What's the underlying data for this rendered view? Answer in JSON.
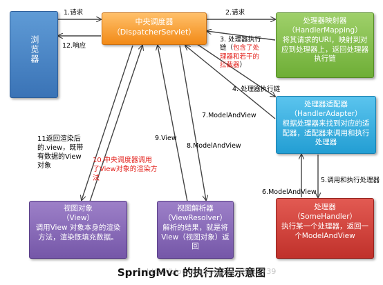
{
  "nodes": {
    "browser": {
      "text": "浏览器"
    },
    "dispatcher": {
      "title": "中央调度器",
      "subtitle": "（DispatcherServlet）"
    },
    "mapping": {
      "title": "处理器映射器",
      "subtitle": "（HandlerMapping）",
      "desc": "将其请求的URI，映射到对应到处理器上，返回处理器执行链"
    },
    "adapter": {
      "title": "处理器适配器",
      "subtitle": "（HandlerAdapter）",
      "desc": "根据处理器来找到对应的适配器，适配器来调用和执行处理器"
    },
    "handler": {
      "title": "处理器",
      "subtitle": "（SomeHandler）",
      "desc": "执行某一个处理器，返回一个ModelAndView"
    },
    "resolver": {
      "title": "视图解析器",
      "subtitle": "（ViewResolver）",
      "desc": "解析的结果，就是将View（视图对象）返回"
    },
    "view": {
      "title": "视图对象",
      "subtitle": "（View）",
      "desc": "调用View 对象本身的渲染方法，渲染既填充数据。"
    }
  },
  "labels": {
    "l1": "1.请求",
    "l12": "12.响应",
    "l2": "2.请求",
    "l3_a": "3. 处理器执行",
    "l3_b": "链（",
    "l3_red1": "包含了处",
    "l3_red2": "理器和若干的",
    "l3_red3": "拦截器",
    "l3_c": "）",
    "l4": "4. 处理器执行链",
    "l7": "7.ModelAndView",
    "l5": "5.调用和执行处理器",
    "l6": "6.ModelAndView",
    "l8": "8.ModelAndView",
    "l9": "9.View",
    "l10": "10.中央调度器调用了View对象的渲染方法",
    "l11": "11返回渲染后的.view，既带有数据的View 对象"
  },
  "caption": "SpringMvc 的执行流程示意图",
  "watermark": "http://blog.csdn.net/qq_28817739",
  "colors": {
    "browser": "#3a73b6",
    "dispatcher": "#f28a17",
    "mapping": "#6eae36",
    "adapter": "#239ed3",
    "view": "#7557a8",
    "resolver": "#7557a8",
    "handler": "#c0312b",
    "highlight_text": "#e3201b"
  }
}
